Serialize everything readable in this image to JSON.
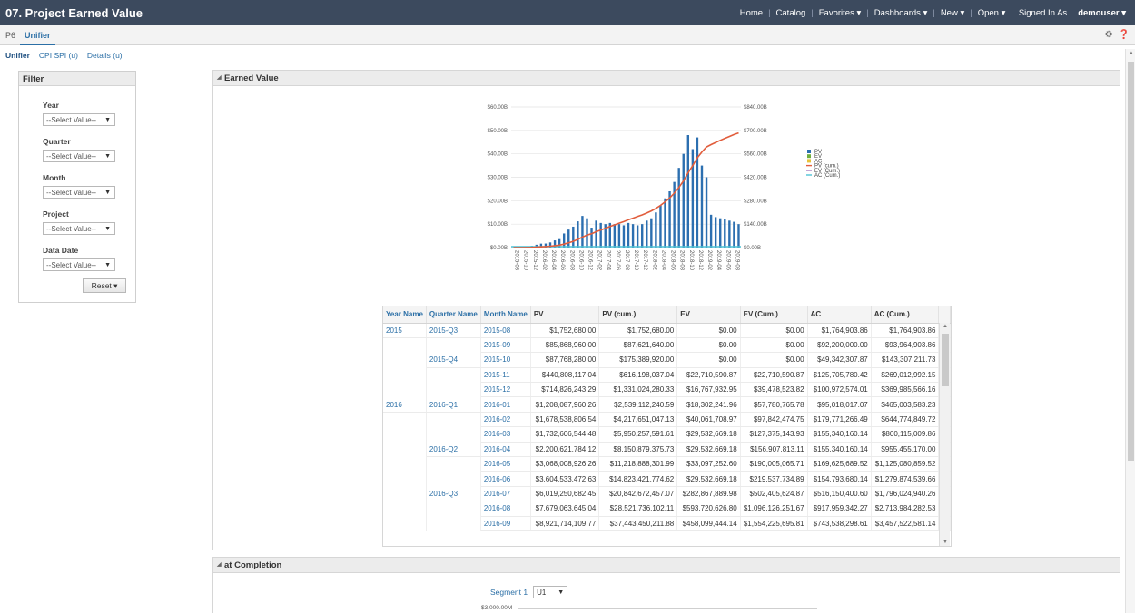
{
  "app": {
    "title": "07. Project Earned Value"
  },
  "topnav": {
    "home": "Home",
    "catalog": "Catalog",
    "favorites": "Favorites ▾",
    "dashboards": "Dashboards ▾",
    "new": "New ▾",
    "open": "Open ▾",
    "signed_in_as": "Signed In As",
    "user": "demouser ▾"
  },
  "tabs": [
    "P6",
    "Unifier"
  ],
  "subtabs": [
    "Unifier",
    "CPI SPI (u)",
    "Details (u)"
  ],
  "filter": {
    "title": "Filter",
    "fields": [
      {
        "label": "Year",
        "value": "--Select Value--"
      },
      {
        "label": "Quarter",
        "value": "--Select Value--"
      },
      {
        "label": "Month",
        "value": "--Select Value--"
      },
      {
        "label": "Project",
        "value": "--Select Value--"
      },
      {
        "label": "Data Date",
        "value": "--Select Value--"
      }
    ],
    "reset": "Reset ▾"
  },
  "earned_value": {
    "title": "Earned Value"
  },
  "at_completion": {
    "title": "at Completion",
    "segment_label": "Segment 1",
    "segment_value": "U1",
    "tick": "$3,000.00M"
  },
  "chart_data": {
    "type": "bar",
    "left_axis_ticks": [
      "$60.00B",
      "$50.00B",
      "$40.00B",
      "$30.00B",
      "$20.00B",
      "$10.00B",
      "$0.00B"
    ],
    "right_axis_ticks": [
      "$840.00B",
      "$700.00B",
      "$560.00B",
      "$420.00B",
      "$280.00B",
      "$140.00B",
      "$0.00B"
    ],
    "ylim_left": [
      0,
      60
    ],
    "ylim_right": [
      0,
      840
    ],
    "x_labels": [
      "2015-08",
      "2015-10",
      "2015-12",
      "2016-02",
      "2016-04",
      "2016-06",
      "2016-08",
      "2016-10",
      "2016-12",
      "2017-02",
      "2017-04",
      "2017-06",
      "2017-08",
      "2017-10",
      "2017-12",
      "2018-02",
      "2018-04",
      "2018-06",
      "2018-08",
      "2018-10",
      "2018-12",
      "2019-02",
      "2019-04",
      "2019-06",
      "2019-08"
    ],
    "months": [
      "2015-08",
      "2015-09",
      "2015-10",
      "2015-11",
      "2015-12",
      "2016-01",
      "2016-02",
      "2016-03",
      "2016-04",
      "2016-05",
      "2016-06",
      "2016-07",
      "2016-08",
      "2016-09",
      "2016-10",
      "2016-11",
      "2016-12",
      "2017-01",
      "2017-02",
      "2017-03",
      "2017-04",
      "2017-05",
      "2017-06",
      "2017-07",
      "2017-08",
      "2017-09",
      "2017-10",
      "2017-11",
      "2017-12",
      "2018-01",
      "2018-02",
      "2018-03",
      "2018-04",
      "2018-05",
      "2018-06",
      "2018-07",
      "2018-08",
      "2018-09",
      "2018-10",
      "2018-11",
      "2018-12",
      "2019-01",
      "2019-02",
      "2019-03",
      "2019-04",
      "2019-05",
      "2019-06",
      "2019-07",
      "2019-08",
      "2019-09"
    ],
    "series": [
      {
        "name": "PV",
        "color": "#2c6fb0",
        "axis": "left",
        "values": [
          0.0,
          0.09,
          0.09,
          0.44,
          0.71,
          1.21,
          1.68,
          1.73,
          2.2,
          3.07,
          3.6,
          6.02,
          7.68,
          8.92,
          11.2,
          13.5,
          12.5,
          8.5,
          11.5,
          10.5,
          10.0,
          10.5,
          10.0,
          10.0,
          9.5,
          10.5,
          10.0,
          9.5,
          10.0,
          11.5,
          12.5,
          15.0,
          18.0,
          21.0,
          24.0,
          28.0,
          34.0,
          40.0,
          48.0,
          42.0,
          47.0,
          35.0,
          30.0,
          14.0,
          13.0,
          12.5,
          12.0,
          11.5,
          11.0,
          10.0
        ]
      },
      {
        "name": "EV",
        "color": "#6fae3c",
        "axis": "left",
        "values": []
      },
      {
        "name": "AC",
        "color": "#e8c23a",
        "axis": "left",
        "values": []
      },
      {
        "name": "PV (cum.)",
        "color": "#e15d3c",
        "axis": "right",
        "values": [
          0.0,
          0.09,
          0.18,
          0.62,
          1.33,
          2.54,
          4.22,
          5.95,
          8.15,
          11.2,
          14.8,
          20.8,
          28.5,
          37.4,
          48.6,
          62.1,
          74.6,
          83.1,
          94.6,
          105.1,
          115.1,
          125.6,
          135.6,
          145.6,
          155.1,
          165.6,
          175.6,
          185.1,
          195.1,
          206.6,
          219.1,
          234.1,
          252.1,
          273.1,
          297.1,
          325.1,
          359.1,
          399.1,
          447.1,
          489.1,
          536.1,
          571.1,
          601.1,
          615.1,
          628.1,
          640.6,
          652.6,
          664.1,
          675.1,
          685.1
        ]
      },
      {
        "name": "EV (Cum.)",
        "color": "#8a4fa8",
        "axis": "right",
        "values": []
      },
      {
        "name": "AC (Cum.)",
        "color": "#4fc3d6",
        "axis": "right",
        "values": []
      }
    ]
  },
  "table": {
    "columns": [
      "Year Name",
      "Quarter Name",
      "Month Name",
      "PV",
      "PV (cum.)",
      "EV",
      "EV (Cum.)",
      "AC",
      "AC (Cum.)"
    ],
    "rows": [
      [
        "2015",
        "2015-Q3",
        "2015-08",
        "$1,752,680.00",
        "$1,752,680.00",
        "$0.00",
        "$0.00",
        "$1,764,903.86",
        "$1,764,903.86"
      ],
      [
        "",
        "",
        "2015-09",
        "$85,868,960.00",
        "$87,621,640.00",
        "$0.00",
        "$0.00",
        "$92,200,000.00",
        "$93,964,903.86"
      ],
      [
        "",
        "2015-Q4",
        "2015-10",
        "$87,768,280.00",
        "$175,389,920.00",
        "$0.00",
        "$0.00",
        "$49,342,307.87",
        "$143,307,211.73"
      ],
      [
        "",
        "",
        "2015-11",
        "$440,808,117.04",
        "$616,198,037.04",
        "$22,710,590.87",
        "$22,710,590.87",
        "$125,705,780.42",
        "$269,012,992.15"
      ],
      [
        "",
        "",
        "2015-12",
        "$714,826,243.29",
        "$1,331,024,280.33",
        "$16,767,932.95",
        "$39,478,523.82",
        "$100,972,574.01",
        "$369,985,566.16"
      ],
      [
        "2016",
        "2016-Q1",
        "2016-01",
        "$1,208,087,960.26",
        "$2,539,112,240.59",
        "$18,302,241.96",
        "$57,780,765.78",
        "$95,018,017.07",
        "$465,003,583.23"
      ],
      [
        "",
        "",
        "2016-02",
        "$1,678,538,806.54",
        "$4,217,651,047.13",
        "$40,061,708.97",
        "$97,842,474.75",
        "$179,771,266.49",
        "$644,774,849.72"
      ],
      [
        "",
        "",
        "2016-03",
        "$1,732,606,544.48",
        "$5,950,257,591.61",
        "$29,532,669.18",
        "$127,375,143.93",
        "$155,340,160.14",
        "$800,115,009.86"
      ],
      [
        "",
        "2016-Q2",
        "2016-04",
        "$2,200,621,784.12",
        "$8,150,879,375.73",
        "$29,532,669.18",
        "$156,907,813.11",
        "$155,340,160.14",
        "$955,455,170.00"
      ],
      [
        "",
        "",
        "2016-05",
        "$3,068,008,926.26",
        "$11,218,888,301.99",
        "$33,097,252.60",
        "$190,005,065.71",
        "$169,625,689.52",
        "$1,125,080,859.52"
      ],
      [
        "",
        "",
        "2016-06",
        "$3,604,533,472.63",
        "$14,823,421,774.62",
        "$29,532,669.18",
        "$219,537,734.89",
        "$154,793,680.14",
        "$1,279,874,539.66"
      ],
      [
        "",
        "2016-Q3",
        "2016-07",
        "$6,019,250,682.45",
        "$20,842,672,457.07",
        "$282,867,889.98",
        "$502,405,624.87",
        "$516,150,400.60",
        "$1,796,024,940.26"
      ],
      [
        "",
        "",
        "2016-08",
        "$7,679,063,645.04",
        "$28,521,736,102.11",
        "$593,720,626.80",
        "$1,096,126,251.67",
        "$917,959,342.27",
        "$2,713,984,282.53"
      ],
      [
        "",
        "",
        "2016-09",
        "$8,921,714,109.77",
        "$37,443,450,211.88",
        "$458,099,444.14",
        "$1,554,225,695.81",
        "$743,538,298.61",
        "$3,457,522,581.14"
      ]
    ]
  }
}
